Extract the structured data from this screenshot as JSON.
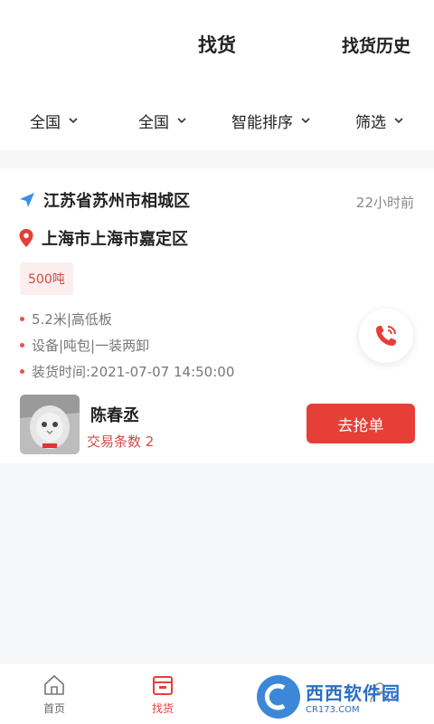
{
  "header": {
    "title": "找货",
    "history_label": "找货历史"
  },
  "filters": [
    {
      "label": "全国"
    },
    {
      "label": "全国"
    },
    {
      "label": "智能排序"
    },
    {
      "label": "筛选"
    }
  ],
  "listing": {
    "origin": "江苏省苏州市相城区",
    "destination": "上海市上海市嘉定区",
    "posted_time": "22小时前",
    "weight_tag": "500吨",
    "details": [
      "5.2米|高低板",
      "设备|吨包|一装两卸",
      "装货时间:2021-07-07 14:50:00"
    ],
    "shipper_name": "陈春丞",
    "deal_count": "交易条数 2",
    "grab_label": "去抢单"
  },
  "tabbar": [
    {
      "label": "首页",
      "icon": "home-icon"
    },
    {
      "label": "找货",
      "icon": "goods-box-icon",
      "active": true
    },
    {
      "label": "",
      "icon": "truck-icon"
    },
    {
      "label": "",
      "icon": "user-icon"
    }
  ],
  "watermark": {
    "big": "西西软件园",
    "small": "CR173.COM"
  },
  "colors": {
    "accent": "#e53f38",
    "nav_blue": "#3a8ee6"
  }
}
